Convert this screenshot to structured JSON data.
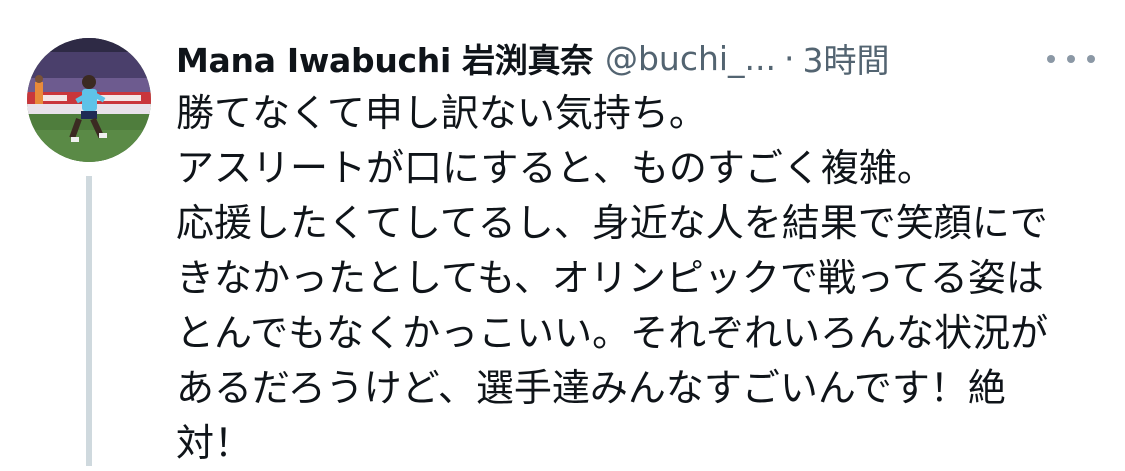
{
  "tweet": {
    "display_name": "Mana Iwabuchi 岩渕真奈",
    "handle": "@buchi_...",
    "separator": "·",
    "timestamp": "3時間",
    "more_icon": "more-horizontal-icon",
    "avatar": "profile-photo-soccer-player",
    "text_lines": [
      "勝てなくて申し訳ない気持ち。",
      "アスリートが口にすると、ものすごく複雑。",
      "応援したくてしてるし、身近な人を結果で笑顔にで",
      "きなかったとしても、オリンピックで戦ってる姿は",
      "とんでもなくかっこいい。それぞれいろんな状況が",
      "あるだろうけど、選手達みんなすごいんです！絶",
      "対！"
    ]
  },
  "colors": {
    "primary_text": "#0f1419",
    "secondary_text": "#536471",
    "thread_line": "#cfd9de"
  }
}
